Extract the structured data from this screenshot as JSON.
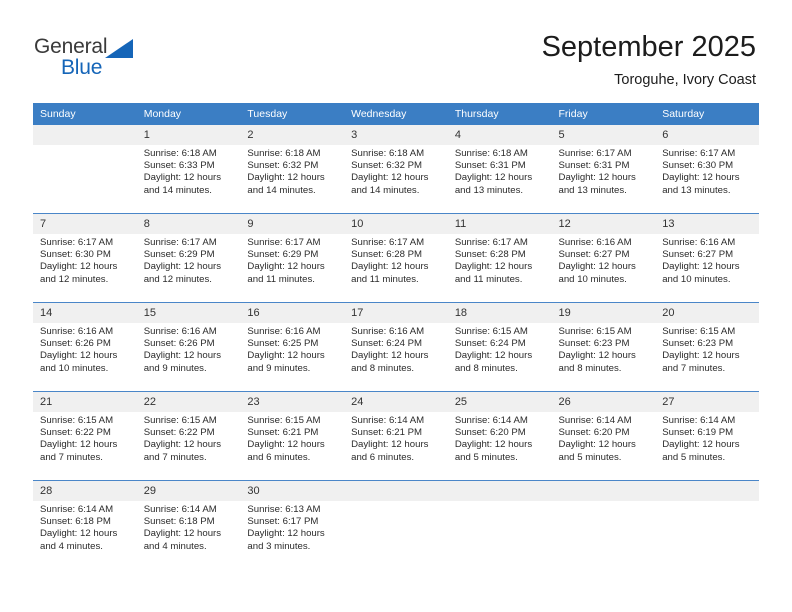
{
  "brand": {
    "name_part1": "General",
    "name_part2": "Blue",
    "triangle_icon": "blue-triangle-logo-mark",
    "color_dark": "#3a3a3a",
    "color_blue": "#1565b8"
  },
  "header": {
    "title": "September 2025",
    "subtitle": "Toroguhe, Ivory Coast"
  },
  "theme": {
    "header_bg": "#3b7ec4",
    "header_text": "#ffffff",
    "daynum_bg": "#f0f0f0",
    "row_divider": "#4a86c8"
  },
  "weekday_headers": [
    "Sunday",
    "Monday",
    "Tuesday",
    "Wednesday",
    "Thursday",
    "Friday",
    "Saturday"
  ],
  "weeks": [
    [
      {
        "day": "",
        "sunrise": "",
        "sunset": "",
        "daylight_line1": "",
        "daylight_line2": "",
        "empty": true
      },
      {
        "day": "1",
        "sunrise": "Sunrise: 6:18 AM",
        "sunset": "Sunset: 6:33 PM",
        "daylight_line1": "Daylight: 12 hours",
        "daylight_line2": "and 14 minutes."
      },
      {
        "day": "2",
        "sunrise": "Sunrise: 6:18 AM",
        "sunset": "Sunset: 6:32 PM",
        "daylight_line1": "Daylight: 12 hours",
        "daylight_line2": "and 14 minutes."
      },
      {
        "day": "3",
        "sunrise": "Sunrise: 6:18 AM",
        "sunset": "Sunset: 6:32 PM",
        "daylight_line1": "Daylight: 12 hours",
        "daylight_line2": "and 14 minutes."
      },
      {
        "day": "4",
        "sunrise": "Sunrise: 6:18 AM",
        "sunset": "Sunset: 6:31 PM",
        "daylight_line1": "Daylight: 12 hours",
        "daylight_line2": "and 13 minutes."
      },
      {
        "day": "5",
        "sunrise": "Sunrise: 6:17 AM",
        "sunset": "Sunset: 6:31 PM",
        "daylight_line1": "Daylight: 12 hours",
        "daylight_line2": "and 13 minutes."
      },
      {
        "day": "6",
        "sunrise": "Sunrise: 6:17 AM",
        "sunset": "Sunset: 6:30 PM",
        "daylight_line1": "Daylight: 12 hours",
        "daylight_line2": "and 13 minutes."
      }
    ],
    [
      {
        "day": "7",
        "sunrise": "Sunrise: 6:17 AM",
        "sunset": "Sunset: 6:30 PM",
        "daylight_line1": "Daylight: 12 hours",
        "daylight_line2": "and 12 minutes."
      },
      {
        "day": "8",
        "sunrise": "Sunrise: 6:17 AM",
        "sunset": "Sunset: 6:29 PM",
        "daylight_line1": "Daylight: 12 hours",
        "daylight_line2": "and 12 minutes."
      },
      {
        "day": "9",
        "sunrise": "Sunrise: 6:17 AM",
        "sunset": "Sunset: 6:29 PM",
        "daylight_line1": "Daylight: 12 hours",
        "daylight_line2": "and 11 minutes."
      },
      {
        "day": "10",
        "sunrise": "Sunrise: 6:17 AM",
        "sunset": "Sunset: 6:28 PM",
        "daylight_line1": "Daylight: 12 hours",
        "daylight_line2": "and 11 minutes."
      },
      {
        "day": "11",
        "sunrise": "Sunrise: 6:17 AM",
        "sunset": "Sunset: 6:28 PM",
        "daylight_line1": "Daylight: 12 hours",
        "daylight_line2": "and 11 minutes."
      },
      {
        "day": "12",
        "sunrise": "Sunrise: 6:16 AM",
        "sunset": "Sunset: 6:27 PM",
        "daylight_line1": "Daylight: 12 hours",
        "daylight_line2": "and 10 minutes."
      },
      {
        "day": "13",
        "sunrise": "Sunrise: 6:16 AM",
        "sunset": "Sunset: 6:27 PM",
        "daylight_line1": "Daylight: 12 hours",
        "daylight_line2": "and 10 minutes."
      }
    ],
    [
      {
        "day": "14",
        "sunrise": "Sunrise: 6:16 AM",
        "sunset": "Sunset: 6:26 PM",
        "daylight_line1": "Daylight: 12 hours",
        "daylight_line2": "and 10 minutes."
      },
      {
        "day": "15",
        "sunrise": "Sunrise: 6:16 AM",
        "sunset": "Sunset: 6:26 PM",
        "daylight_line1": "Daylight: 12 hours",
        "daylight_line2": "and 9 minutes."
      },
      {
        "day": "16",
        "sunrise": "Sunrise: 6:16 AM",
        "sunset": "Sunset: 6:25 PM",
        "daylight_line1": "Daylight: 12 hours",
        "daylight_line2": "and 9 minutes."
      },
      {
        "day": "17",
        "sunrise": "Sunrise: 6:16 AM",
        "sunset": "Sunset: 6:24 PM",
        "daylight_line1": "Daylight: 12 hours",
        "daylight_line2": "and 8 minutes."
      },
      {
        "day": "18",
        "sunrise": "Sunrise: 6:15 AM",
        "sunset": "Sunset: 6:24 PM",
        "daylight_line1": "Daylight: 12 hours",
        "daylight_line2": "and 8 minutes."
      },
      {
        "day": "19",
        "sunrise": "Sunrise: 6:15 AM",
        "sunset": "Sunset: 6:23 PM",
        "daylight_line1": "Daylight: 12 hours",
        "daylight_line2": "and 8 minutes."
      },
      {
        "day": "20",
        "sunrise": "Sunrise: 6:15 AM",
        "sunset": "Sunset: 6:23 PM",
        "daylight_line1": "Daylight: 12 hours",
        "daylight_line2": "and 7 minutes."
      }
    ],
    [
      {
        "day": "21",
        "sunrise": "Sunrise: 6:15 AM",
        "sunset": "Sunset: 6:22 PM",
        "daylight_line1": "Daylight: 12 hours",
        "daylight_line2": "and 7 minutes."
      },
      {
        "day": "22",
        "sunrise": "Sunrise: 6:15 AM",
        "sunset": "Sunset: 6:22 PM",
        "daylight_line1": "Daylight: 12 hours",
        "daylight_line2": "and 7 minutes."
      },
      {
        "day": "23",
        "sunrise": "Sunrise: 6:15 AM",
        "sunset": "Sunset: 6:21 PM",
        "daylight_line1": "Daylight: 12 hours",
        "daylight_line2": "and 6 minutes."
      },
      {
        "day": "24",
        "sunrise": "Sunrise: 6:14 AM",
        "sunset": "Sunset: 6:21 PM",
        "daylight_line1": "Daylight: 12 hours",
        "daylight_line2": "and 6 minutes."
      },
      {
        "day": "25",
        "sunrise": "Sunrise: 6:14 AM",
        "sunset": "Sunset: 6:20 PM",
        "daylight_line1": "Daylight: 12 hours",
        "daylight_line2": "and 5 minutes."
      },
      {
        "day": "26",
        "sunrise": "Sunrise: 6:14 AM",
        "sunset": "Sunset: 6:20 PM",
        "daylight_line1": "Daylight: 12 hours",
        "daylight_line2": "and 5 minutes."
      },
      {
        "day": "27",
        "sunrise": "Sunrise: 6:14 AM",
        "sunset": "Sunset: 6:19 PM",
        "daylight_line1": "Daylight: 12 hours",
        "daylight_line2": "and 5 minutes."
      }
    ],
    [
      {
        "day": "28",
        "sunrise": "Sunrise: 6:14 AM",
        "sunset": "Sunset: 6:18 PM",
        "daylight_line1": "Daylight: 12 hours",
        "daylight_line2": "and 4 minutes."
      },
      {
        "day": "29",
        "sunrise": "Sunrise: 6:14 AM",
        "sunset": "Sunset: 6:18 PM",
        "daylight_line1": "Daylight: 12 hours",
        "daylight_line2": "and 4 minutes."
      },
      {
        "day": "30",
        "sunrise": "Sunrise: 6:13 AM",
        "sunset": "Sunset: 6:17 PM",
        "daylight_line1": "Daylight: 12 hours",
        "daylight_line2": "and 3 minutes."
      },
      {
        "day": "",
        "sunrise": "",
        "sunset": "",
        "daylight_line1": "",
        "daylight_line2": "",
        "empty": true
      },
      {
        "day": "",
        "sunrise": "",
        "sunset": "",
        "daylight_line1": "",
        "daylight_line2": "",
        "empty": true
      },
      {
        "day": "",
        "sunrise": "",
        "sunset": "",
        "daylight_line1": "",
        "daylight_line2": "",
        "empty": true
      },
      {
        "day": "",
        "sunrise": "",
        "sunset": "",
        "daylight_line1": "",
        "daylight_line2": "",
        "empty": true
      }
    ]
  ]
}
